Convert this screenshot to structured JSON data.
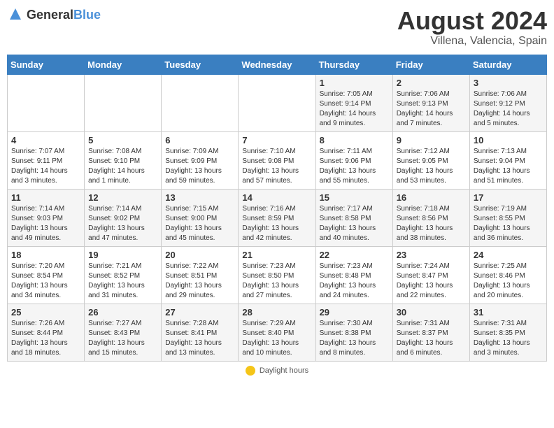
{
  "header": {
    "logo_line1": "General",
    "logo_line2": "Blue",
    "month_year": "August 2024",
    "location": "Villena, Valencia, Spain"
  },
  "days_of_week": [
    "Sunday",
    "Monday",
    "Tuesday",
    "Wednesday",
    "Thursday",
    "Friday",
    "Saturday"
  ],
  "weeks": [
    [
      {
        "day": "",
        "info": ""
      },
      {
        "day": "",
        "info": ""
      },
      {
        "day": "",
        "info": ""
      },
      {
        "day": "",
        "info": ""
      },
      {
        "day": "1",
        "info": "Sunrise: 7:05 AM\nSunset: 9:14 PM\nDaylight: 14 hours\nand 9 minutes."
      },
      {
        "day": "2",
        "info": "Sunrise: 7:06 AM\nSunset: 9:13 PM\nDaylight: 14 hours\nand 7 minutes."
      },
      {
        "day": "3",
        "info": "Sunrise: 7:06 AM\nSunset: 9:12 PM\nDaylight: 14 hours\nand 5 minutes."
      }
    ],
    [
      {
        "day": "4",
        "info": "Sunrise: 7:07 AM\nSunset: 9:11 PM\nDaylight: 14 hours\nand 3 minutes."
      },
      {
        "day": "5",
        "info": "Sunrise: 7:08 AM\nSunset: 9:10 PM\nDaylight: 14 hours\nand 1 minute."
      },
      {
        "day": "6",
        "info": "Sunrise: 7:09 AM\nSunset: 9:09 PM\nDaylight: 13 hours\nand 59 minutes."
      },
      {
        "day": "7",
        "info": "Sunrise: 7:10 AM\nSunset: 9:08 PM\nDaylight: 13 hours\nand 57 minutes."
      },
      {
        "day": "8",
        "info": "Sunrise: 7:11 AM\nSunset: 9:06 PM\nDaylight: 13 hours\nand 55 minutes."
      },
      {
        "day": "9",
        "info": "Sunrise: 7:12 AM\nSunset: 9:05 PM\nDaylight: 13 hours\nand 53 minutes."
      },
      {
        "day": "10",
        "info": "Sunrise: 7:13 AM\nSunset: 9:04 PM\nDaylight: 13 hours\nand 51 minutes."
      }
    ],
    [
      {
        "day": "11",
        "info": "Sunrise: 7:14 AM\nSunset: 9:03 PM\nDaylight: 13 hours\nand 49 minutes."
      },
      {
        "day": "12",
        "info": "Sunrise: 7:14 AM\nSunset: 9:02 PM\nDaylight: 13 hours\nand 47 minutes."
      },
      {
        "day": "13",
        "info": "Sunrise: 7:15 AM\nSunset: 9:00 PM\nDaylight: 13 hours\nand 45 minutes."
      },
      {
        "day": "14",
        "info": "Sunrise: 7:16 AM\nSunset: 8:59 PM\nDaylight: 13 hours\nand 42 minutes."
      },
      {
        "day": "15",
        "info": "Sunrise: 7:17 AM\nSunset: 8:58 PM\nDaylight: 13 hours\nand 40 minutes."
      },
      {
        "day": "16",
        "info": "Sunrise: 7:18 AM\nSunset: 8:56 PM\nDaylight: 13 hours\nand 38 minutes."
      },
      {
        "day": "17",
        "info": "Sunrise: 7:19 AM\nSunset: 8:55 PM\nDaylight: 13 hours\nand 36 minutes."
      }
    ],
    [
      {
        "day": "18",
        "info": "Sunrise: 7:20 AM\nSunset: 8:54 PM\nDaylight: 13 hours\nand 34 minutes."
      },
      {
        "day": "19",
        "info": "Sunrise: 7:21 AM\nSunset: 8:52 PM\nDaylight: 13 hours\nand 31 minutes."
      },
      {
        "day": "20",
        "info": "Sunrise: 7:22 AM\nSunset: 8:51 PM\nDaylight: 13 hours\nand 29 minutes."
      },
      {
        "day": "21",
        "info": "Sunrise: 7:23 AM\nSunset: 8:50 PM\nDaylight: 13 hours\nand 27 minutes."
      },
      {
        "day": "22",
        "info": "Sunrise: 7:23 AM\nSunset: 8:48 PM\nDaylight: 13 hours\nand 24 minutes."
      },
      {
        "day": "23",
        "info": "Sunrise: 7:24 AM\nSunset: 8:47 PM\nDaylight: 13 hours\nand 22 minutes."
      },
      {
        "day": "24",
        "info": "Sunrise: 7:25 AM\nSunset: 8:46 PM\nDaylight: 13 hours\nand 20 minutes."
      }
    ],
    [
      {
        "day": "25",
        "info": "Sunrise: 7:26 AM\nSunset: 8:44 PM\nDaylight: 13 hours\nand 18 minutes."
      },
      {
        "day": "26",
        "info": "Sunrise: 7:27 AM\nSunset: 8:43 PM\nDaylight: 13 hours\nand 15 minutes."
      },
      {
        "day": "27",
        "info": "Sunrise: 7:28 AM\nSunset: 8:41 PM\nDaylight: 13 hours\nand 13 minutes."
      },
      {
        "day": "28",
        "info": "Sunrise: 7:29 AM\nSunset: 8:40 PM\nDaylight: 13 hours\nand 10 minutes."
      },
      {
        "day": "29",
        "info": "Sunrise: 7:30 AM\nSunset: 8:38 PM\nDaylight: 13 hours\nand 8 minutes."
      },
      {
        "day": "30",
        "info": "Sunrise: 7:31 AM\nSunset: 8:37 PM\nDaylight: 13 hours\nand 6 minutes."
      },
      {
        "day": "31",
        "info": "Sunrise: 7:31 AM\nSunset: 8:35 PM\nDaylight: 13 hours\nand 3 minutes."
      }
    ]
  ],
  "legend": {
    "label": "Daylight hours"
  }
}
